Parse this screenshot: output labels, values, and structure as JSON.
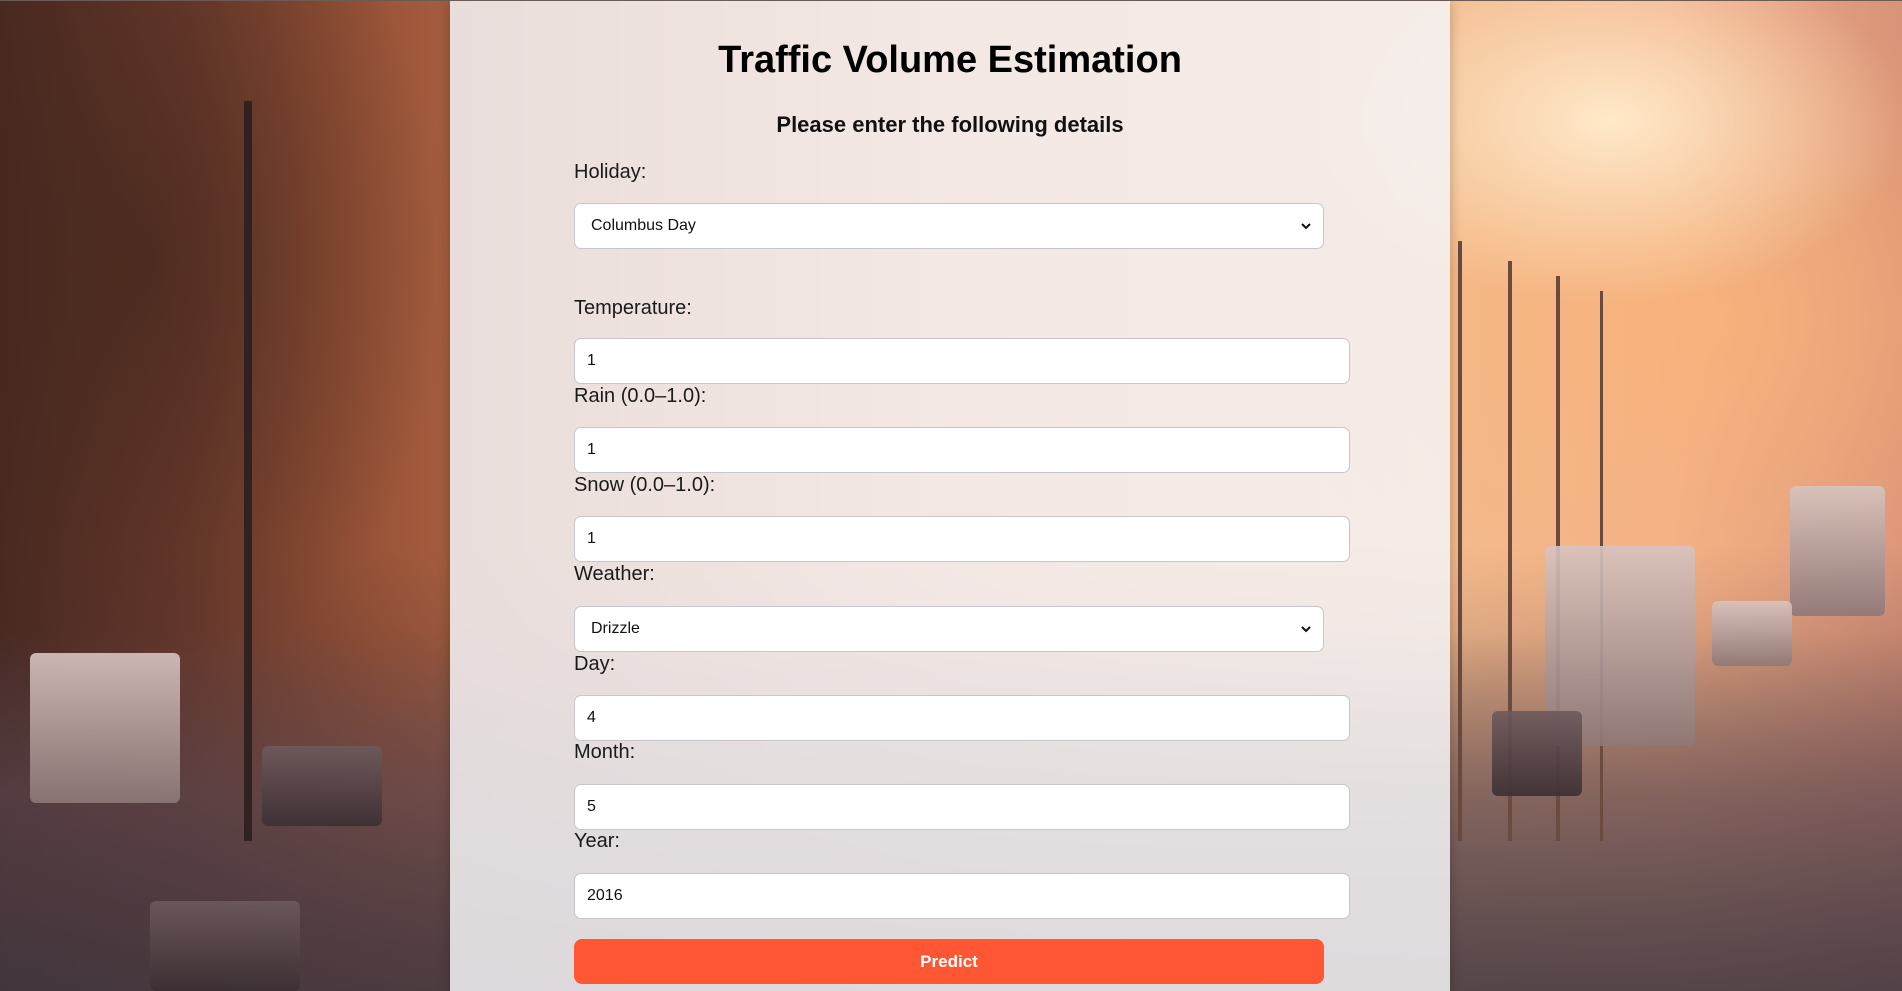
{
  "title": "Traffic Volume Estimation",
  "subtitle": "Please enter the following details",
  "form": {
    "holiday": {
      "label": "Holiday:",
      "value": "Columbus Day"
    },
    "temperature": {
      "label": "Temperature:",
      "value": "1"
    },
    "rain": {
      "label": "Rain (0.0–1.0):",
      "value": "1"
    },
    "snow": {
      "label": "Snow (0.0–1.0):",
      "value": "1"
    },
    "weather": {
      "label": "Weather:",
      "value": "Drizzle"
    },
    "day": {
      "label": "Day:",
      "value": "4"
    },
    "month": {
      "label": "Month:",
      "value": "5"
    },
    "year": {
      "label": "Year:",
      "value": "2016"
    },
    "predict_label": "Predict"
  },
  "icons": {
    "select_indicator": "chevron-down-icon"
  },
  "colors": {
    "accent": "#ff5733",
    "panel": "#f5f3f6"
  }
}
